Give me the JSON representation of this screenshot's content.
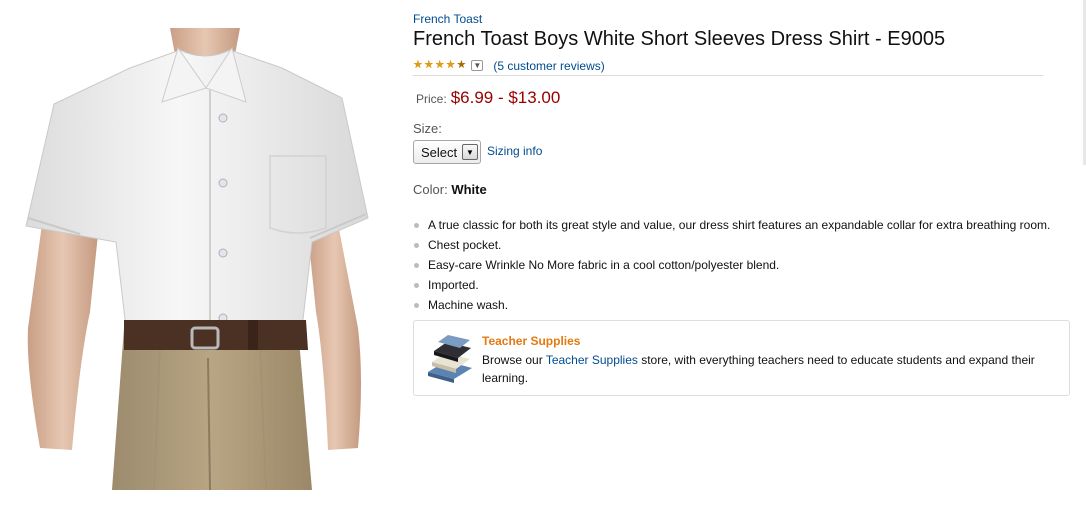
{
  "product": {
    "brand": "French Toast",
    "title": "French Toast Boys White Short Sleeves Dress Shirt - E9005",
    "rating": {
      "value": 4.5,
      "max": 5,
      "reviews_text": "(5 customer reviews)"
    },
    "price": {
      "label": "Price:",
      "value": "$6.99 - $13.00"
    },
    "size": {
      "label": "Size:",
      "selected": "Select",
      "sizing_link": "Sizing info"
    },
    "color": {
      "label": "Color:",
      "value": "White"
    },
    "features": [
      "A true classic for both its great style and value, our dress shirt features an expandable collar for extra breathing room.",
      "Chest pocket.",
      "Easy-care Wrinkle No More fabric in a cool cotton/polyester blend.",
      "Imported.",
      "Machine wash."
    ]
  },
  "promo": {
    "title": "Teacher Supplies",
    "text_before": "Browse our ",
    "link": "Teacher Supplies",
    "text_after": " store, with everything teachers need to educate students and expand their learning."
  },
  "colors": {
    "link": "#004b91",
    "price": "#990000",
    "star": "#e69a0d",
    "promo_title": "#e47911"
  },
  "icons": {
    "product_image": "boys-white-dress-shirt-photo",
    "dropdown": "chevron-down-icon",
    "promo": "stacked-books-icon"
  }
}
